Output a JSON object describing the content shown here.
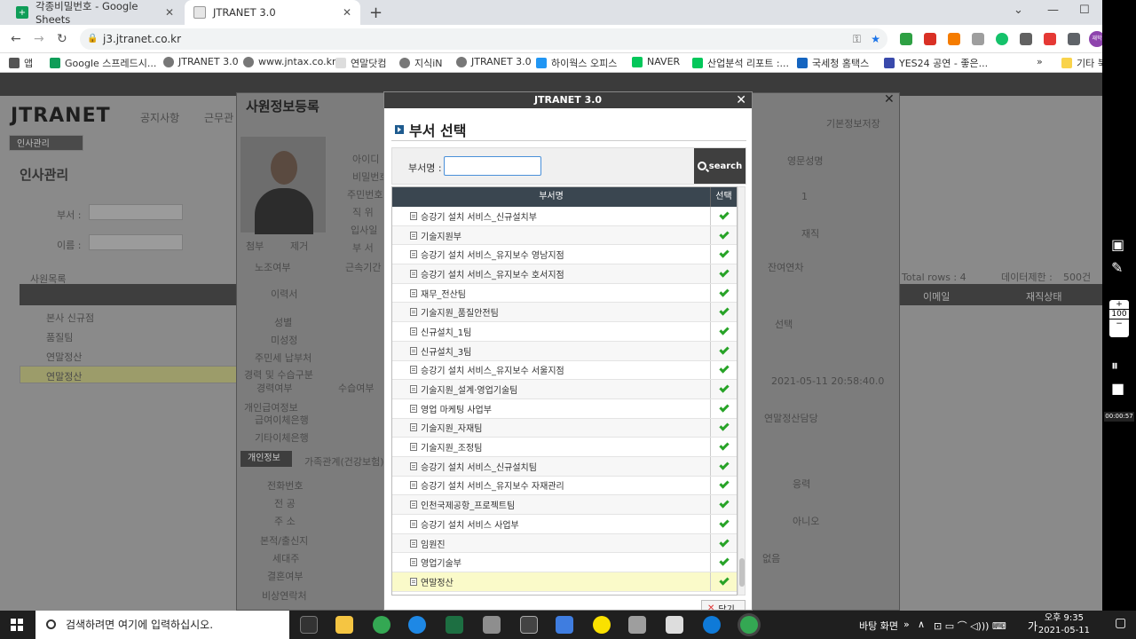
{
  "browser": {
    "tabs": [
      {
        "title": "각종비밀번호 - Google Sheets",
        "active": false
      },
      {
        "title": "JTRANET 3.0",
        "active": true
      }
    ],
    "url": "j3.jtranet.co.kr",
    "bookmarks": [
      "앱",
      "Google 스프레드시...",
      "JTRANET 3.0",
      "www.jntax.co.kr",
      "연말닷컴",
      "지식iN",
      "JTRANET 3.0",
      "하이웍스 오피스",
      "NAVER",
      "산업분석 리포트 :...",
      "국세청 홈택스",
      "YES24 공연 - 좋은...",
      "기타 북"
    ],
    "profile_label": "재학"
  },
  "app": {
    "logo": "JTRANET",
    "nav": [
      "공지사항",
      "근무관"
    ],
    "outer_modal_title": "사원정보등록",
    "outer_save_label": "기본정보저장",
    "page_title": "인사관리",
    "left_tab": "인사관리",
    "fields_left": [
      "부서 :",
      "이름 :"
    ],
    "member_list_label": "사원목록",
    "outer_form_labels": [
      "아이디",
      "비밀번호",
      "주민번호",
      "직 위",
      "입사일",
      "부 서",
      "노조여부",
      "근속기간",
      "이력서",
      "성별",
      "미성정",
      "주민세 납부처",
      "경력 및 수습구분",
      "경력여부",
      "수습여부",
      "개인급여정보",
      "급여이체은행",
      "기타이체은행",
      "개인정보",
      "가족관계(건강보험)",
      "전화번호",
      "전 공",
      "주 소",
      "본적/출신지",
      "세대주",
      "결혼여부",
      "비상연락처"
    ],
    "outer_buttons": [
      "첨부",
      "제거"
    ],
    "right_labels": [
      "영문성명",
      "재직",
      "선택",
      "1",
      "잔여연차",
      "Total rows : 4",
      "데이터제한 :",
      "500건",
      "이메일",
      "재직상태",
      "2021-05-11 20:58:40.0",
      "연말정산담당",
      "응력",
      "아니오",
      "없음"
    ],
    "list_rows": [
      "본사 신규점",
      "품질팀",
      "연말정산",
      "연말정산"
    ]
  },
  "modal": {
    "window_title": "JTRANET 3.0",
    "heading": "부서 선택",
    "search_label": "부서명 :",
    "search_value": "",
    "search_button": "search",
    "columns": {
      "name": "부서명",
      "select": "선택"
    },
    "rows": [
      "승강기 설치 서비스_신규설치부",
      "기술지원부",
      "승강기 설치 서비스_유지보수 영남지점",
      "승강기 설치 서비스_유지보수 호서지점",
      "재무_전산팀",
      "기술지원_품질안전팀",
      "신규설치_1팀",
      "신규설치_3팀",
      "승강기 설치 서비스_유지보수 서울지점",
      "기술지원_설계·영업기술팀",
      "영업 마케팅 사업부",
      "기술지원_자재팀",
      "기술지원_조정팀",
      "승강기 설치 서비스_신규설치팀",
      "승강기 설치 서비스_유지보수 자재관리",
      "인천국제공항_프로젝트팀",
      "승강기 설치 서비스 사업부",
      "임원진",
      "영업기술부",
      "연말정산"
    ],
    "selected_row": "연말정산",
    "close_label": "닫기"
  },
  "side_tools": {
    "zoom": "100",
    "timer": "00:00:57"
  },
  "taskbar": {
    "search_placeholder": "검색하려면 여기에 입력하십시오.",
    "tray_text": "바탕 화면",
    "ime": "가",
    "time": "오후 9:35",
    "date": "2021-05-11"
  },
  "colors": {
    "modal_header": "#3c3c3c",
    "grid_header": "#3a4650",
    "check": "#27a327",
    "selected_row": "#fafac9",
    "search_border": "#4a90d9"
  }
}
